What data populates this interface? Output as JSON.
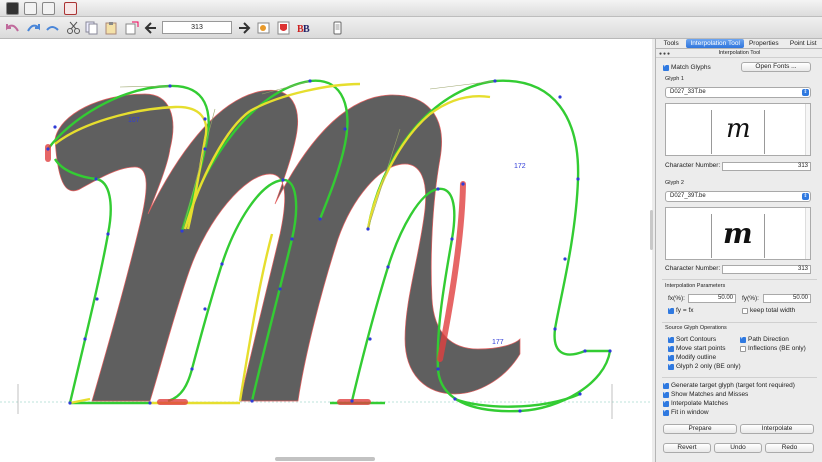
{
  "toolbar": {
    "glyph_number": "313"
  },
  "canvas": {
    "contour_labels": [
      "107",
      "172",
      "177"
    ],
    "colors": {
      "glyph_fill": "#5f5f5f",
      "match": "#2ecf2e",
      "mismatch_yellow": "#e8e035",
      "error_red": "#e03b3b",
      "point": "#2f3bd8"
    }
  },
  "panel": {
    "tabs": [
      "Tools",
      "Interpolation Tool",
      "Properties",
      "Point List"
    ],
    "active_tab": "Interpolation Tool",
    "title": "Interpolation Tool",
    "match_glyphs": "Match Glyphs",
    "open_fonts": "Open Fonts ...",
    "glyph1": {
      "label": "Glyph 1",
      "font": "D027_33T.be",
      "char_label": "Character Number:",
      "char_value": "313",
      "preview_glyph": "m"
    },
    "glyph2": {
      "label": "Glyph 2",
      "font": "D027_39T.be",
      "char_label": "Character Number:",
      "char_value": "313",
      "preview_glyph": "m"
    },
    "interp_params": {
      "heading": "Interpolation Parameters",
      "fx_label": "fx(%):",
      "fx_value": "50.00",
      "fy_label": "fy(%):",
      "fy_value": "50.00",
      "fy_eq_fx": "fy = fx",
      "keep_total_width": "keep total width"
    },
    "source_ops": {
      "heading": "Source Glyph Operations",
      "sort_contours": "Sort Contours",
      "path_direction": "Path Direction",
      "move_start_points": "Move start points",
      "inflections": "Inflections (BE only)",
      "modify_outline": "Modify outline",
      "glyph2_only": "Glyph 2 only (BE only)"
    },
    "options": {
      "generate_target": "Generate target glyph (target font required)",
      "show_matches": "Show Matches and Misses",
      "interpolate_matches": "Interpolate Matches",
      "fit_in_window": "Fit in window"
    },
    "buttons": {
      "prepare": "Prepare",
      "interpolate": "Interpolate",
      "revert": "Revert",
      "undo": "Undo",
      "redo": "Redo"
    }
  }
}
